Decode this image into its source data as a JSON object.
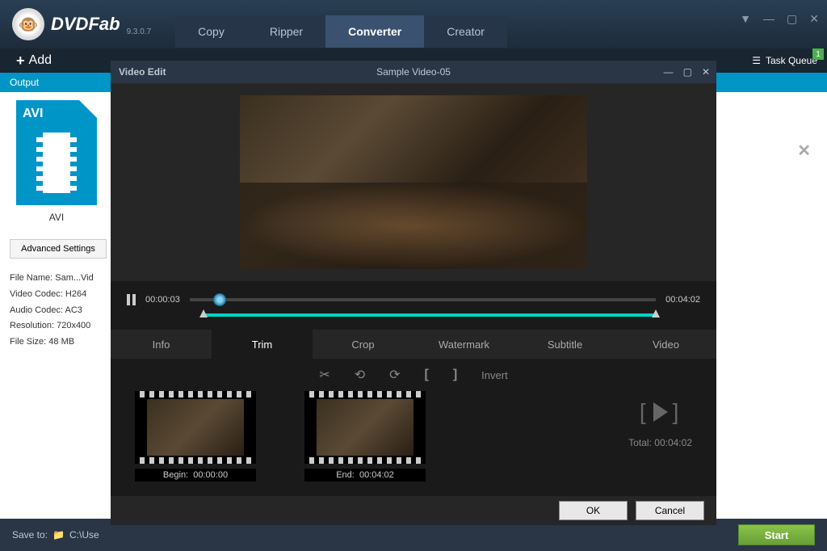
{
  "app": {
    "name": "DVDFab",
    "version": "9.3.0.7"
  },
  "mainTabs": [
    "Copy",
    "Ripper",
    "Converter",
    "Creator"
  ],
  "addLabel": "Add",
  "taskQueue": {
    "label": "Task Queue",
    "count": "1"
  },
  "outputLabel": "Output",
  "format": {
    "badge": "AVI",
    "name": "AVI"
  },
  "advancedSettings": "Advanced Settings",
  "fileInfo": {
    "name": "File Name: Sam...Vid",
    "vcodec": "Video Codec: H264",
    "acodec": "Audio Codec: AC3",
    "res": "Resolution: 720x400",
    "size": "File Size: 48 MB"
  },
  "modal": {
    "title": "Video Edit",
    "subtitle": "Sample Video-05",
    "currentTime": "00:00:03",
    "duration": "00:04:02",
    "tabs": [
      "Info",
      "Trim",
      "Crop",
      "Watermark",
      "Subtitle",
      "Video"
    ],
    "invert": "Invert",
    "begin": {
      "label": "Begin:",
      "time": "00:00:00"
    },
    "end": {
      "label": "End:",
      "time": "00:04:02"
    },
    "total": {
      "label": "Total:",
      "time": "00:04:02"
    },
    "ok": "OK",
    "cancel": "Cancel"
  },
  "bottom": {
    "saveTo": "Save to:",
    "path": "C:\\Use",
    "start": "Start"
  }
}
